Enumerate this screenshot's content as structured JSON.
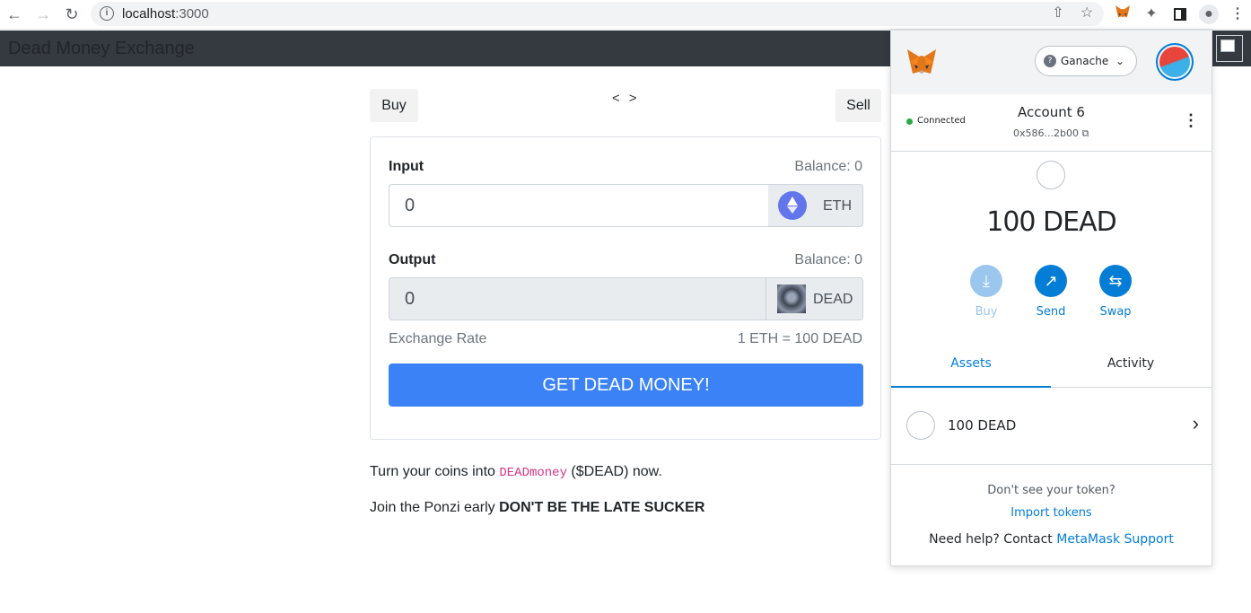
{
  "browser": {
    "url_host": "localhost",
    "url_port": ":3000"
  },
  "app": {
    "brand": "Dead Money Exchange",
    "buy_tab": "Buy",
    "sell_tab": "Sell",
    "prev_arrow": "<",
    "next_arrow": ">",
    "input": {
      "label": "Input",
      "balance": "Balance: 0",
      "value": "0",
      "token": "ETH"
    },
    "output": {
      "label": "Output",
      "balance": "Balance: 0",
      "value": "0",
      "token": "DEAD"
    },
    "exchange_rate_label": "Exchange Rate",
    "exchange_rate_value": "1 ETH = 100 DEAD",
    "cta": "GET DEAD MONEY!",
    "tagline_pre": "Turn your coins into ",
    "tagline_code": "DEADmoney",
    "tagline_post": " ($DEAD) now.",
    "ponzi_pre": "Join the Ponzi early ",
    "ponzi_bold": "DON'T BE THE LATE SUCKER"
  },
  "metamask": {
    "network": "Ganache",
    "network_icon": "?",
    "connected": "Connected",
    "account_name": "Account 6",
    "account_address": "0x586...2b00",
    "balance": "100 DEAD",
    "actions": {
      "buy": "Buy",
      "send": "Send",
      "swap": "Swap"
    },
    "tabs": {
      "assets": "Assets",
      "activity": "Activity"
    },
    "asset_row": "100 DEAD",
    "dont_see": "Don't see your token?",
    "import_tokens": "Import tokens",
    "help_pre": "Need help? Contact ",
    "help_link": "MetaMask Support"
  },
  "colors": {
    "accent": "#037dd6",
    "cta": "#3b82f6",
    "navbar": "#343a40"
  }
}
